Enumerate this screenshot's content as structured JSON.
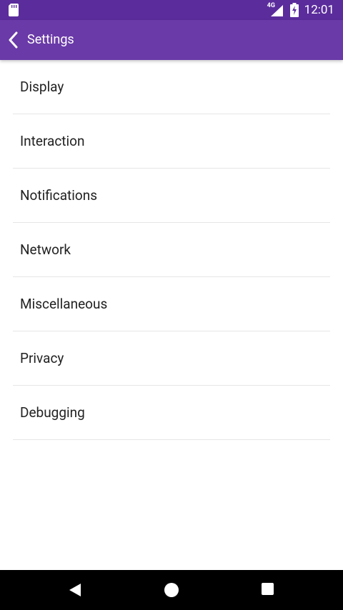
{
  "status_bar": {
    "network_label": "4G",
    "time": "12:01",
    "left_icon": "sd-card-icon",
    "signal_icon": "signal-icon",
    "battery_icon": "battery-charging-icon"
  },
  "app_bar": {
    "title": "Settings",
    "back_icon": "chevron-left-icon",
    "background_color": "#6a3aa8"
  },
  "settings": {
    "items": [
      {
        "label": "Display"
      },
      {
        "label": "Interaction"
      },
      {
        "label": "Notifications"
      },
      {
        "label": "Network"
      },
      {
        "label": "Miscellaneous"
      },
      {
        "label": "Privacy"
      },
      {
        "label": "Debugging"
      }
    ]
  },
  "nav_bar": {
    "back_icon": "triangle-back-icon",
    "home_icon": "circle-home-icon",
    "recents_icon": "square-recents-icon"
  },
  "colors": {
    "status_bar": "#5b2c9c",
    "app_bar": "#6a3aa8",
    "nav_bar": "#000000"
  }
}
